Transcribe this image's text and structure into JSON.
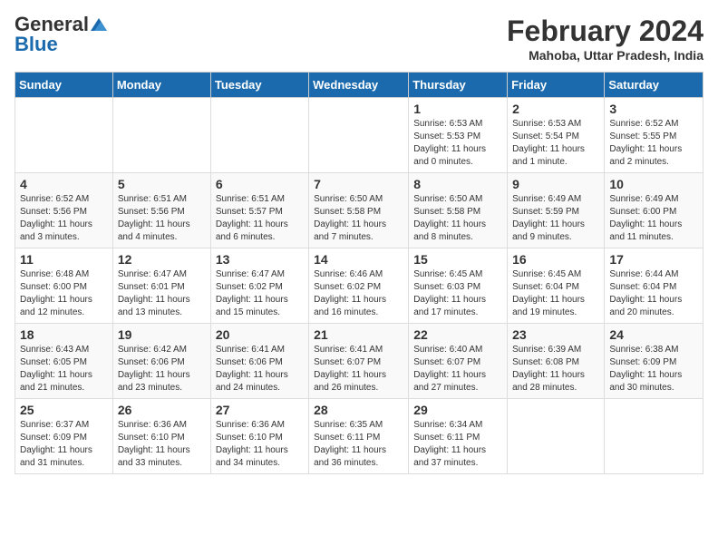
{
  "header": {
    "logo_general": "General",
    "logo_blue": "Blue",
    "month_year": "February 2024",
    "location": "Mahoba, Uttar Pradesh, India"
  },
  "days_of_week": [
    "Sunday",
    "Monday",
    "Tuesday",
    "Wednesday",
    "Thursday",
    "Friday",
    "Saturday"
  ],
  "weeks": [
    [
      {
        "day": "",
        "sunrise": "",
        "sunset": "",
        "daylight": ""
      },
      {
        "day": "",
        "sunrise": "",
        "sunset": "",
        "daylight": ""
      },
      {
        "day": "",
        "sunrise": "",
        "sunset": "",
        "daylight": ""
      },
      {
        "day": "",
        "sunrise": "",
        "sunset": "",
        "daylight": ""
      },
      {
        "day": "1",
        "sunrise": "6:53 AM",
        "sunset": "5:53 PM",
        "daylight": "11 hours and 0 minutes."
      },
      {
        "day": "2",
        "sunrise": "6:53 AM",
        "sunset": "5:54 PM",
        "daylight": "11 hours and 1 minute."
      },
      {
        "day": "3",
        "sunrise": "6:52 AM",
        "sunset": "5:55 PM",
        "daylight": "11 hours and 2 minutes."
      }
    ],
    [
      {
        "day": "4",
        "sunrise": "6:52 AM",
        "sunset": "5:56 PM",
        "daylight": "11 hours and 3 minutes."
      },
      {
        "day": "5",
        "sunrise": "6:51 AM",
        "sunset": "5:56 PM",
        "daylight": "11 hours and 4 minutes."
      },
      {
        "day": "6",
        "sunrise": "6:51 AM",
        "sunset": "5:57 PM",
        "daylight": "11 hours and 6 minutes."
      },
      {
        "day": "7",
        "sunrise": "6:50 AM",
        "sunset": "5:58 PM",
        "daylight": "11 hours and 7 minutes."
      },
      {
        "day": "8",
        "sunrise": "6:50 AM",
        "sunset": "5:58 PM",
        "daylight": "11 hours and 8 minutes."
      },
      {
        "day": "9",
        "sunrise": "6:49 AM",
        "sunset": "5:59 PM",
        "daylight": "11 hours and 9 minutes."
      },
      {
        "day": "10",
        "sunrise": "6:49 AM",
        "sunset": "6:00 PM",
        "daylight": "11 hours and 11 minutes."
      }
    ],
    [
      {
        "day": "11",
        "sunrise": "6:48 AM",
        "sunset": "6:00 PM",
        "daylight": "11 hours and 12 minutes."
      },
      {
        "day": "12",
        "sunrise": "6:47 AM",
        "sunset": "6:01 PM",
        "daylight": "11 hours and 13 minutes."
      },
      {
        "day": "13",
        "sunrise": "6:47 AM",
        "sunset": "6:02 PM",
        "daylight": "11 hours and 15 minutes."
      },
      {
        "day": "14",
        "sunrise": "6:46 AM",
        "sunset": "6:02 PM",
        "daylight": "11 hours and 16 minutes."
      },
      {
        "day": "15",
        "sunrise": "6:45 AM",
        "sunset": "6:03 PM",
        "daylight": "11 hours and 17 minutes."
      },
      {
        "day": "16",
        "sunrise": "6:45 AM",
        "sunset": "6:04 PM",
        "daylight": "11 hours and 19 minutes."
      },
      {
        "day": "17",
        "sunrise": "6:44 AM",
        "sunset": "6:04 PM",
        "daylight": "11 hours and 20 minutes."
      }
    ],
    [
      {
        "day": "18",
        "sunrise": "6:43 AM",
        "sunset": "6:05 PM",
        "daylight": "11 hours and 21 minutes."
      },
      {
        "day": "19",
        "sunrise": "6:42 AM",
        "sunset": "6:06 PM",
        "daylight": "11 hours and 23 minutes."
      },
      {
        "day": "20",
        "sunrise": "6:41 AM",
        "sunset": "6:06 PM",
        "daylight": "11 hours and 24 minutes."
      },
      {
        "day": "21",
        "sunrise": "6:41 AM",
        "sunset": "6:07 PM",
        "daylight": "11 hours and 26 minutes."
      },
      {
        "day": "22",
        "sunrise": "6:40 AM",
        "sunset": "6:07 PM",
        "daylight": "11 hours and 27 minutes."
      },
      {
        "day": "23",
        "sunrise": "6:39 AM",
        "sunset": "6:08 PM",
        "daylight": "11 hours and 28 minutes."
      },
      {
        "day": "24",
        "sunrise": "6:38 AM",
        "sunset": "6:09 PM",
        "daylight": "11 hours and 30 minutes."
      }
    ],
    [
      {
        "day": "25",
        "sunrise": "6:37 AM",
        "sunset": "6:09 PM",
        "daylight": "11 hours and 31 minutes."
      },
      {
        "day": "26",
        "sunrise": "6:36 AM",
        "sunset": "6:10 PM",
        "daylight": "11 hours and 33 minutes."
      },
      {
        "day": "27",
        "sunrise": "6:36 AM",
        "sunset": "6:10 PM",
        "daylight": "11 hours and 34 minutes."
      },
      {
        "day": "28",
        "sunrise": "6:35 AM",
        "sunset": "6:11 PM",
        "daylight": "11 hours and 36 minutes."
      },
      {
        "day": "29",
        "sunrise": "6:34 AM",
        "sunset": "6:11 PM",
        "daylight": "11 hours and 37 minutes."
      },
      {
        "day": "",
        "sunrise": "",
        "sunset": "",
        "daylight": ""
      },
      {
        "day": "",
        "sunrise": "",
        "sunset": "",
        "daylight": ""
      }
    ]
  ]
}
